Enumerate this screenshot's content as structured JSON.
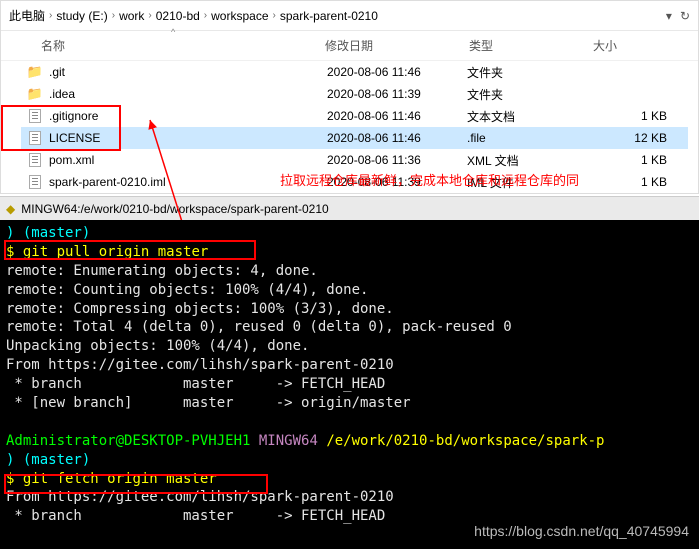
{
  "breadcrumb": [
    "此电脑",
    "study (E:)",
    "work",
    "0210-bd",
    "workspace",
    "spark-parent-0210"
  ],
  "columns": {
    "name": "名称",
    "date": "修改日期",
    "type": "类型",
    "size": "大小"
  },
  "files": [
    {
      "name": ".git",
      "date": "2020-08-06 11:46",
      "type": "文件夹",
      "size": "",
      "icon": "folder"
    },
    {
      "name": ".idea",
      "date": "2020-08-06 11:39",
      "type": "文件夹",
      "size": "",
      "icon": "folder"
    },
    {
      "name": ".gitignore",
      "date": "2020-08-06 11:46",
      "type": "文本文档",
      "size": "1 KB",
      "icon": "txt"
    },
    {
      "name": "LICENSE",
      "date": "2020-08-06 11:46",
      "type": ".file",
      "size": "12 KB",
      "icon": "txt",
      "selected": true
    },
    {
      "name": "pom.xml",
      "date": "2020-08-06 11:36",
      "type": "XML 文档",
      "size": "1 KB",
      "icon": "txt"
    },
    {
      "name": "spark-parent-0210.iml",
      "date": "2020-08-06 11:39",
      "type": "IML 文件",
      "size": "1 KB",
      "icon": "txt"
    }
  ],
  "annotation": "拉取远程仓库最新鲜，完成本地仓库和远程仓库的同",
  "titlebar": "MINGW64:/e/work/0210-bd/workspace/spark-parent-0210",
  "terminal": {
    "l0": ") (master)",
    "cmd1_prompt": "$",
    "cmd1": "git pull origin master",
    "l2": "remote: Enumerating objects: 4, done.",
    "l3": "remote: Counting objects: 100% (4/4), done.",
    "l4": "remote: Compressing objects: 100% (3/3), done.",
    "l5": "remote: Total 4 (delta 0), reused 0 (delta 0), pack-reused 0",
    "l6": "Unpacking objects: 100% (4/4), done.",
    "l7": "From https://gitee.com/lihsh/spark-parent-0210",
    "l8": " * branch            master     -> FETCH_HEAD",
    "l9": " * [new branch]      master     -> origin/master",
    "prompt2_user": "Administrator@DESKTOP-PVHJEH1",
    "prompt2_env": "MINGW64",
    "prompt2_path": "/e/work/0210-bd/workspace/spark-p",
    "prompt2_branch": ") (master)",
    "cmd2_prompt": "$",
    "cmd2": "git fetch origin master",
    "l12": "From https://gitee.com/lihsh/spark-parent-0210",
    "l13": " * branch            master     -> FETCH_HEAD"
  },
  "watermark": "https://blog.csdn.net/qq_40745994"
}
